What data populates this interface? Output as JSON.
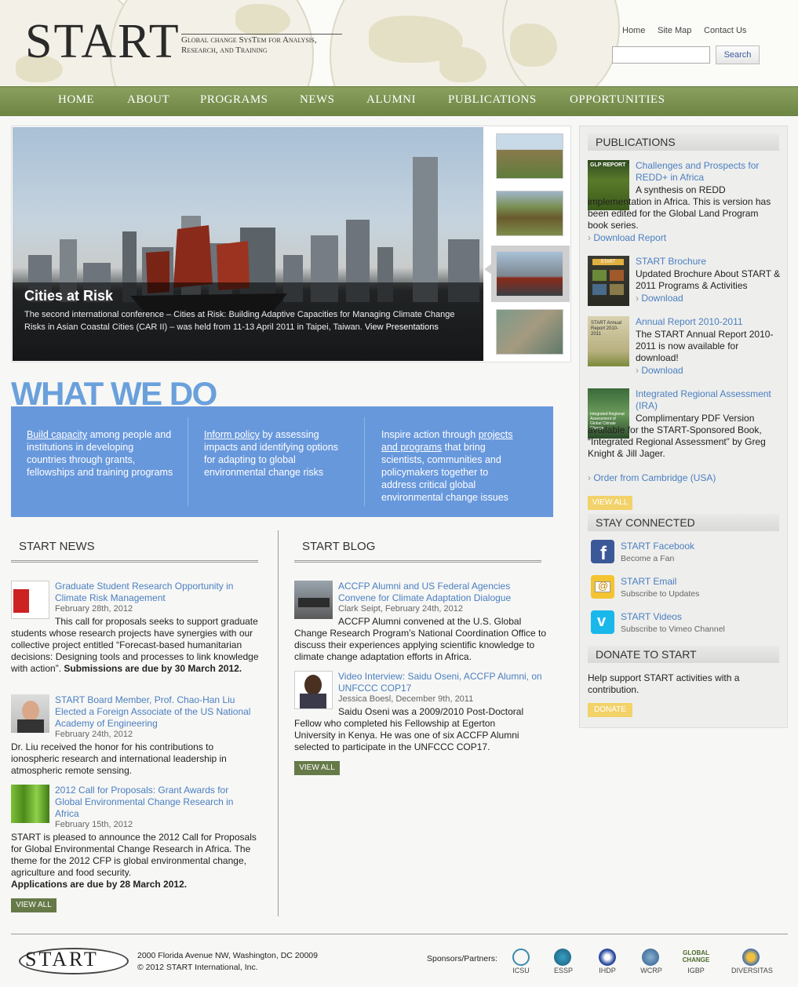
{
  "header": {
    "logo": "START",
    "tagline_1": "Global change SysTem for Analysis,",
    "tagline_2": "Research, and Training",
    "links": [
      "Home",
      "Site Map",
      "Contact Us"
    ],
    "search_button": "Search",
    "search_value": ""
  },
  "nav": [
    "HOME",
    "ABOUT",
    "PROGRAMS",
    "NEWS",
    "ALUMNI",
    "PUBLICATIONS",
    "OPPORTUNITIES"
  ],
  "slider": {
    "title": "Cities at Risk",
    "text": "The second international conference – Cities at Risk: Building Adaptive Capacities for Managing Climate Change Risks in Asian Coastal Cities (CAR II) – was held from 11-13 April 2011 in Taipei, Taiwan.",
    "link": "View Presentations"
  },
  "what_we_do": {
    "title": "WHAT WE DO",
    "col1_link": "Build capacity",
    "col1_text": " among people and institutions in developing countries through grants, fellowships and training programs",
    "col2_link": "Inform policy",
    "col2_text": " by assessing impacts and identifying options for adapting to global environmental change risks",
    "col3_pre": "Inspire action through ",
    "col3_link": "projects and programs",
    "col3_text": " that bring scientists, communities and policymakers together to address critical global environmental change issues"
  },
  "news": {
    "title": "START NEWS",
    "items": [
      {
        "title": "Graduate Student Research Opportunity in Climate Risk Management",
        "date": "February 28th, 2012",
        "body": "This call for proposals seeks to support graduate students whose research projects have synergies with our collective project entitled “Forecast-based humanitarian decisions: Designing tools and processes to link knowledge with action”.",
        "bold": "Submissions are due by 30 March 2012."
      },
      {
        "title": "START Board Member, Prof. Chao-Han Liu Elected a Foreign Associate of the US National Academy of Engineering",
        "date": "February 24th, 2012",
        "body": "Dr. Liu received the honor for his contributions to ionospheric research and international leadership in atmospheric remote sensing.",
        "bold": ""
      },
      {
        "title": "2012 Call for Proposals: Grant Awards for Global Environmental Change Research in Africa",
        "date": "February 15th, 2012",
        "body": "START is pleased to announce the 2012 Call for Proposals for Global Environmental Change Research in Africa. The theme for the 2012 CFP is global environmental change, agriculture and food security.",
        "bold": "Applications are due by 28 March 2012."
      }
    ],
    "view_all": "VIEW ALL"
  },
  "blog": {
    "title": "START BLOG",
    "items": [
      {
        "title": "ACCFP Alumni and US Federal Agencies Convene for Climate Adaptation Dialogue",
        "meta": "Clark Seipt, February 24th, 2012",
        "body": "ACCFP Alumni convened at the U.S. Global Change Research Program’s National Coordination Office to discuss their experiences applying scientific knowledge to climate change adaptation efforts in Africa."
      },
      {
        "title": "Video Interview: Saidu Oseni, ACCFP Alumni, on UNFCCC COP17",
        "meta": "Jessica Boesl, December 9th, 2011",
        "body": "Saidu Oseni was a 2009/2010 Post-Doctoral Fellow who completed his Fellowship at Egerton University in Kenya. He was one of six ACCFP Alumni selected to participate in the UNFCCC COP17."
      }
    ],
    "view_all": "VIEW ALL"
  },
  "sidebar": {
    "publications_title": "PUBLICATIONS",
    "pubs": [
      {
        "cover": "GLP REPORT",
        "title": "Challenges and Prospects for REDD+ in Africa",
        "body": "A synthesis on REDD implementation in Africa. This is version has been edited for the Global Land Program book series.",
        "link": "Download Report"
      },
      {
        "cover": "START",
        "title": "START Brochure",
        "body": "Updated Brochure About START & 2011 Programs & Activities",
        "link": "Download"
      },
      {
        "cover": "START Annual Report 2010-2011",
        "title": "Annual Report 2010-2011",
        "body": "The START Annual Report 2010-2011 is now available for download!",
        "link": "Download"
      },
      {
        "cover": "Integrated Regional Assessment of Global Climate Change",
        "title": "Integrated Regional Assessment (IRA)",
        "body": "Complimentary PDF Version available for the START-Sponsored Book, “Integrated Regional Assessment” by Greg Knight & Jill Jager.",
        "link": "Order from Cambridge (USA)"
      }
    ],
    "pubs_view_all": "VIEW ALL",
    "connected_title": "STAY CONNECTED",
    "social": [
      {
        "title": "START Facebook",
        "sub": "Become a Fan",
        "icon": "facebook-icon"
      },
      {
        "title": "START Email",
        "sub": "Subscribe to Updates",
        "icon": "email-icon"
      },
      {
        "title": "START Videos",
        "sub": "Subscribe to Vimeo Channel",
        "icon": "vimeo-icon"
      }
    ],
    "donate_title": "DONATE TO START",
    "donate_text": "Help support START activities with a contribution.",
    "donate_button": "DONATE"
  },
  "footer": {
    "logo": "START",
    "address": "2000 Florida Avenue NW, Washington, DC 20009",
    "copyright": "© 2012 START International, Inc.",
    "sponsors_label": "Sponsors/Partners:",
    "sponsors": [
      "ICSU",
      "ESSP",
      "IHDP",
      "WCRP",
      "IGBP",
      "DIVERSITAS"
    ],
    "global_change_logo": "GLOBAL CHANGE"
  },
  "colors": {
    "nav": "#7a9150",
    "accent_blue": "#6898dc",
    "link": "#4a7fc1",
    "button_green": "#667a48",
    "button_yellow": "#f2d269"
  }
}
